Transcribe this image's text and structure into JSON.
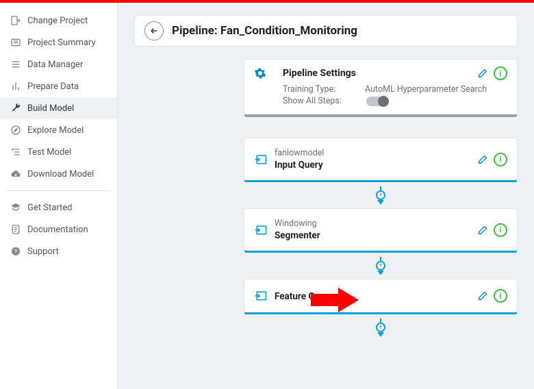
{
  "header": {
    "title": "Pipeline: Fan_Condition_Monitoring"
  },
  "sidebar": {
    "items": [
      {
        "label": "Change Project"
      },
      {
        "label": "Project Summary"
      },
      {
        "label": "Data Manager"
      },
      {
        "label": "Prepare Data"
      },
      {
        "label": "Build Model",
        "active": true
      },
      {
        "label": "Explore Model"
      },
      {
        "label": "Test Model"
      },
      {
        "label": "Download Model"
      }
    ],
    "items2": [
      {
        "label": "Get Started"
      },
      {
        "label": "Documentation"
      },
      {
        "label": "Support"
      }
    ]
  },
  "settings": {
    "title": "Pipeline Settings",
    "training_type_label": "Training Type:",
    "training_type_value": "AutoML Hyperparameter Search",
    "show_all_label": "Show All Steps:",
    "show_all_state": false
  },
  "steps": [
    {
      "sub": "fanlowmodel",
      "title": "Input Query"
    },
    {
      "sub": "Windowing",
      "title": "Segmenter"
    },
    {
      "sub": "",
      "title": "Feature Generator"
    }
  ],
  "colors": {
    "accent": "#0aa2d5",
    "info": "#3cbf3c",
    "danger": "#ff0000"
  }
}
